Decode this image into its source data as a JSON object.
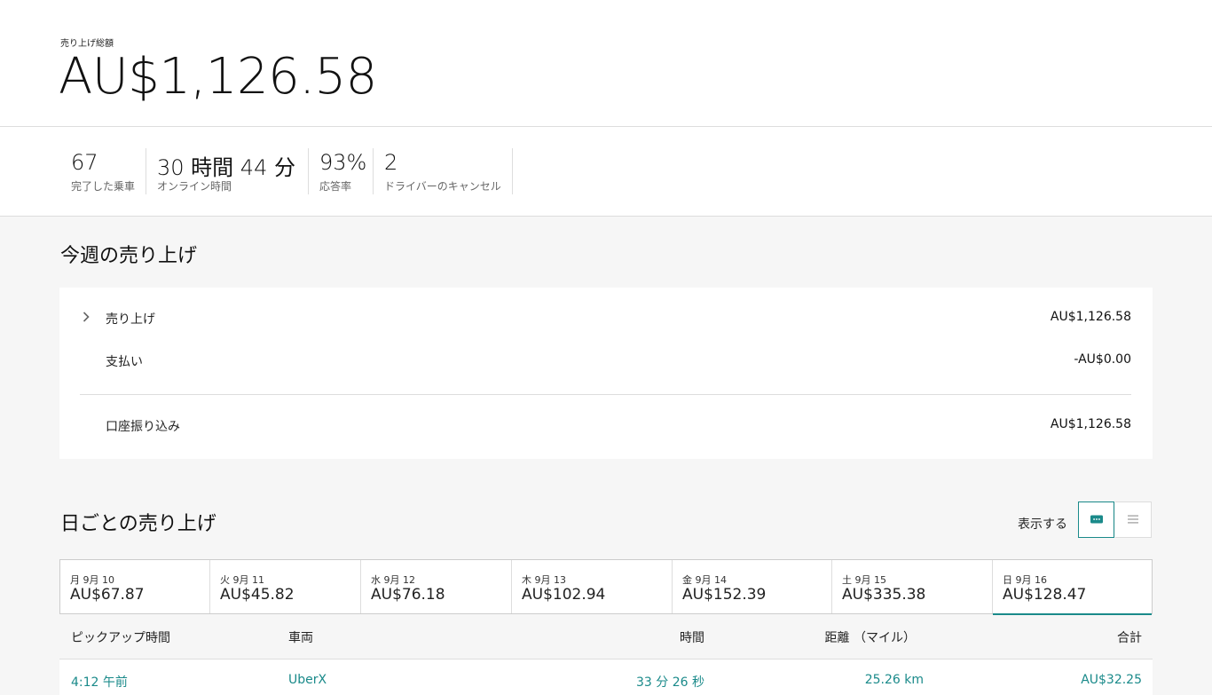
{
  "hero": {
    "label": "売り上げ総額",
    "amount": "AU$1,126.58"
  },
  "stats": [
    {
      "value": "67",
      "label": "完了した乗車"
    },
    {
      "value": "30 時間 44 分",
      "label": "オンライン時間"
    },
    {
      "value": "93%",
      "label": "応答率"
    },
    {
      "value": "2",
      "label": "ドライバーのキャンセル"
    }
  ],
  "weekly": {
    "title": "今週の売り上げ",
    "earnings": {
      "label": "売り上げ",
      "value": "AU$1,126.58"
    },
    "payouts": {
      "label": "支払い",
      "value": "-AU$0.00"
    },
    "bank_transfer": {
      "label": "口座振り込み",
      "value": "AU$1,126.58"
    }
  },
  "daily": {
    "title": "日ごとの売り上げ",
    "view_label": "表示する",
    "days": [
      {
        "date": "月 9月 10",
        "amount": "AU$67.87"
      },
      {
        "date": "火 9月 11",
        "amount": "AU$45.82"
      },
      {
        "date": "水 9月 12",
        "amount": "AU$76.18"
      },
      {
        "date": "木 9月 13",
        "amount": "AU$102.94"
      },
      {
        "date": "金 9月 14",
        "amount": "AU$152.39"
      },
      {
        "date": "土 9月 15",
        "amount": "AU$335.38"
      },
      {
        "date": "日 9月 16",
        "amount": "AU$128.47"
      }
    ],
    "selected_day": 6
  },
  "trips_table": {
    "headers": {
      "pickup_time": "ピックアップ時間",
      "vehicle": "車両",
      "duration": "時間",
      "distance": "距離 （マイル）",
      "total": "合計"
    },
    "rows": [
      {
        "pickup_time": "4:12 午前",
        "vehicle": "UberX",
        "duration": "33 分 26 秒",
        "distance": "25.26 km",
        "total": "AU$32.25"
      }
    ]
  },
  "colors": {
    "accent": "#1a8a8a",
    "background": "#f6f6f6",
    "card": "#ffffff"
  }
}
